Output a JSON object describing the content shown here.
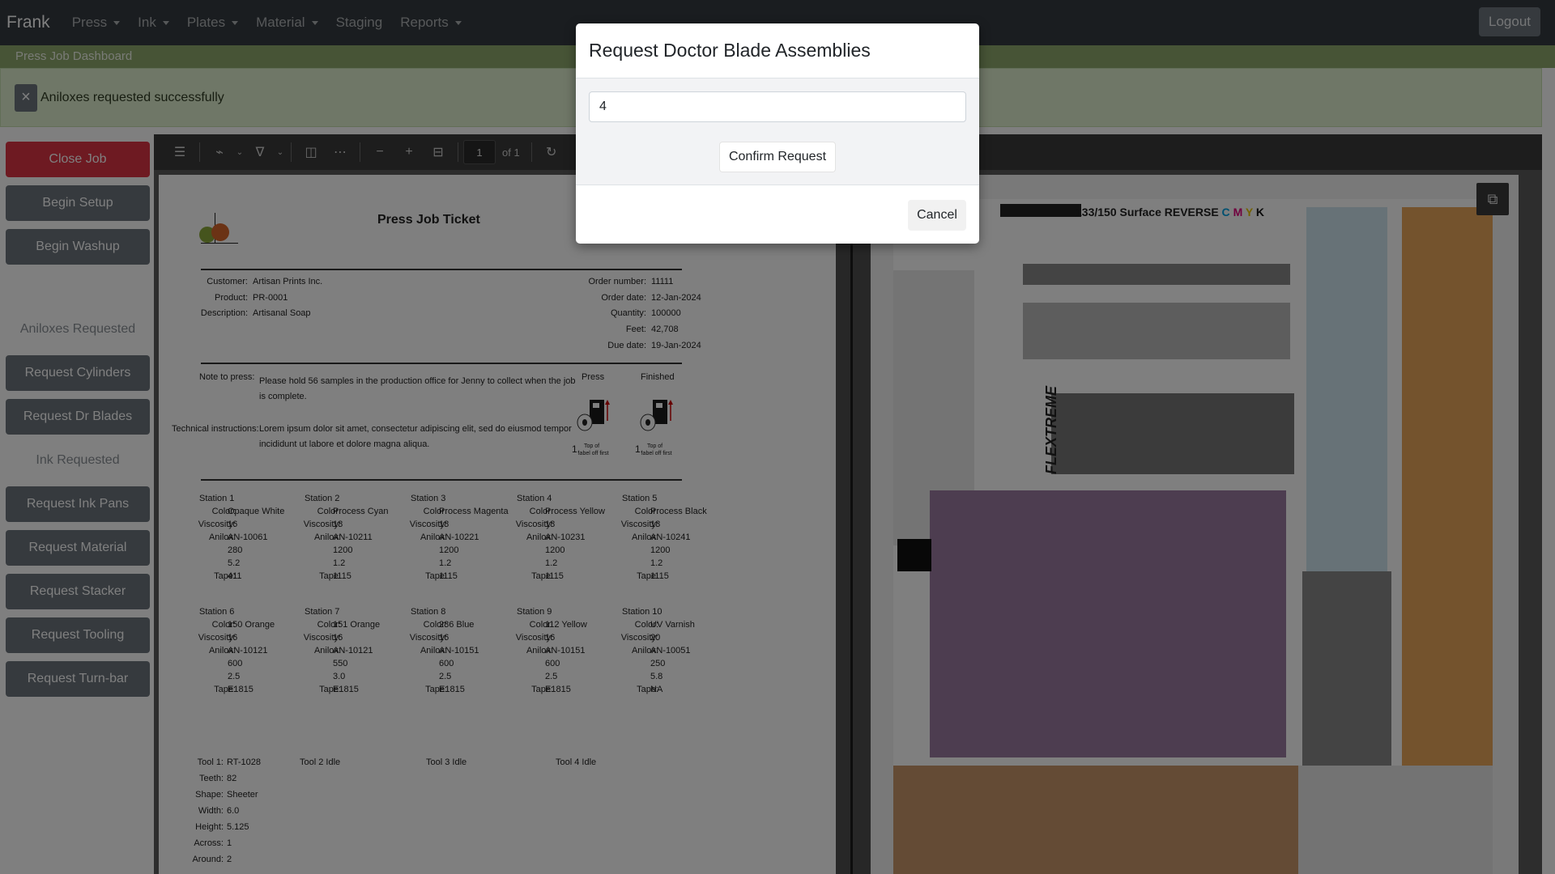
{
  "nav": {
    "brand": "Frank",
    "items": [
      "Press",
      "Ink",
      "Plates",
      "Material",
      "Staging",
      "Reports"
    ],
    "logout": "Logout"
  },
  "breadcrumb": "Press Job Dashboard",
  "alert": {
    "close": "×",
    "message": "Aniloxes requested successfully"
  },
  "sidebar": {
    "close_job": "Close Job",
    "begin_setup": "Begin Setup",
    "begin_washup": "Begin Washup",
    "aniloxes_requested": "Aniloxes Requested",
    "request_cylinders": "Request Cylinders",
    "request_dr_blades": "Request Dr Blades",
    "ink_requested": "Ink Requested",
    "request_ink_pans": "Request Ink Pans",
    "request_material": "Request Material",
    "request_stacker": "Request Stacker",
    "request_tooling": "Request Tooling",
    "request_turnbar": "Request Turn-bar"
  },
  "viewer": {
    "page_number": "1",
    "page_total": "of 1"
  },
  "ticket": {
    "title": "Press Job Ticket",
    "customer_label": "Customer:",
    "customer": "Artisan Prints Inc.",
    "product_label": "Product:",
    "product": "PR-0001",
    "description_label": "Description:",
    "description": "Artisanal Soap",
    "order_number_label": "Order number:",
    "order_number": "11111",
    "order_date_label": "Order date:",
    "order_date": "12-Jan-2024",
    "quantity_label": "Quantity:",
    "quantity": "100000",
    "feet_label": "Feet:",
    "feet": "42,708",
    "due_date_label": "Due date:",
    "due_date": "19-Jan-2024",
    "note_label": "Note to press:",
    "note_line1": "Please hold 56 samples in the production office for Jenny to collect when the job",
    "note_line2": "is complete.",
    "tech_label": "Technical instructions:",
    "tech_line1": "Lorem ipsum dolor sit amet, consectetur adipiscing elit, sed do eiusmod tempor",
    "tech_line2": "incididunt ut labore et dolore magna aliqua.",
    "press_label": "Press",
    "finished_label": "Finished",
    "roll_caption1": "Top of",
    "roll_caption2": "label off first",
    "roll_number": "1.",
    "labels": {
      "color": "Color:",
      "viscosity": "Viscosity:",
      "anilox": "Anilox:",
      "tape": "Tape:"
    },
    "stations": [
      {
        "name": "Station 1",
        "color": "Opaque White",
        "viscosity": "16",
        "anilox": "AN-10061",
        "lpi": "280",
        "bcm": "5.2",
        "tape": "411"
      },
      {
        "name": "Station 2",
        "color": "Process Cyan",
        "viscosity": "18",
        "anilox": "AN-10211",
        "lpi": "1200",
        "bcm": "1.2",
        "tape": "1115"
      },
      {
        "name": "Station 3",
        "color": "Process Magenta",
        "viscosity": "18",
        "anilox": "AN-10221",
        "lpi": "1200",
        "bcm": "1.2",
        "tape": "1115"
      },
      {
        "name": "Station 4",
        "color": "Process Yellow",
        "viscosity": "18",
        "anilox": "AN-10231",
        "lpi": "1200",
        "bcm": "1.2",
        "tape": "1115"
      },
      {
        "name": "Station 5",
        "color": "Process Black",
        "viscosity": "18",
        "anilox": "AN-10241",
        "lpi": "1200",
        "bcm": "1.2",
        "tape": "1115"
      },
      {
        "name": "Station 6",
        "color": "150 Orange",
        "viscosity": "16",
        "anilox": "AN-10121",
        "lpi": "600",
        "bcm": "2.5",
        "tape": "E1815"
      },
      {
        "name": "Station 7",
        "color": "151 Orange",
        "viscosity": "16",
        "anilox": "AN-10121",
        "lpi": "550",
        "bcm": "3.0",
        "tape": "E1815"
      },
      {
        "name": "Station 8",
        "color": "286 Blue",
        "viscosity": "16",
        "anilox": "AN-10151",
        "lpi": "600",
        "bcm": "2.5",
        "tape": "E1815"
      },
      {
        "name": "Station 9",
        "color": "112 Yellow",
        "viscosity": "16",
        "anilox": "AN-10151",
        "lpi": "600",
        "bcm": "2.5",
        "tape": "E1815"
      },
      {
        "name": "Station 10",
        "color": "UV Varnish",
        "viscosity": "20",
        "anilox": "AN-10051",
        "lpi": "250",
        "bcm": "5.8",
        "tape": "NA"
      }
    ],
    "tool1_label": "Tool 1:",
    "tool1": "RT-1028",
    "teeth_label": "Teeth:",
    "teeth": "82",
    "shape_label": "Shape:",
    "shape": "Sheeter",
    "width_label": "Width:",
    "width": "6.0",
    "height_label": "Height:",
    "height": "5.125",
    "across_label": "Across:",
    "across": "1",
    "around_label": "Around:",
    "around": "2",
    "tool2": "Tool 2 Idle",
    "tool3": "Tool 3 Idle",
    "tool4": "Tool 4 Idle"
  },
  "proof": {
    "title_main": "133/150 Surface REVERSE",
    "c": "C",
    "m": "M",
    "y": "Y",
    "k": "K",
    "brand": "FLEXTREME"
  },
  "modal": {
    "title": "Request Doctor Blade Assemblies",
    "input_value": "4",
    "confirm": "Confirm Request",
    "cancel": "Cancel"
  }
}
